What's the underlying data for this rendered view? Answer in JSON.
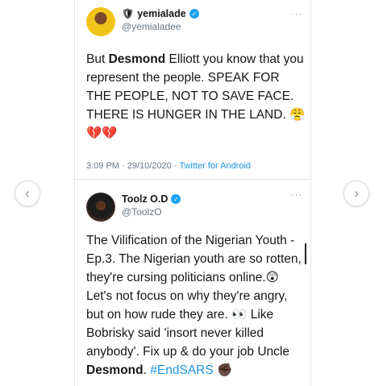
{
  "tweets": [
    {
      "name": "yemialade",
      "name_emoji": "🛡",
      "handle": "@yemialadee",
      "text_parts": {
        "a": "But ",
        "b": "Desmond",
        "c": " Elliott you know that you represent the people. SPEAK FOR THE PEOPLE, NOT TO SAVE FACE. THERE IS HUNGER IN THE LAND. 😤 💔💔"
      },
      "time": "3:09 PM · 29/10/2020 · ",
      "source": "Twitter for Android"
    },
    {
      "name": "Toolz O.D",
      "handle": "@ToolzO",
      "text_parts": {
        "a": "The Vilification of the Nigerian Youth - Ep.3. The Nigerian youth are so rotten, they're cursing politicians online.😲 Let's not focus on why they're angry, but on how rude they are. 👀 Like Bobrisky said 'insort never killed anybody'. Fix up & do your job Uncle ",
        "b": "Desmond",
        "c": ". ",
        "hashtag": "#EndSARS",
        "d": " ✊🏿"
      }
    }
  ],
  "nav": {
    "prev": "‹",
    "next": "›"
  },
  "more_glyph": "···"
}
